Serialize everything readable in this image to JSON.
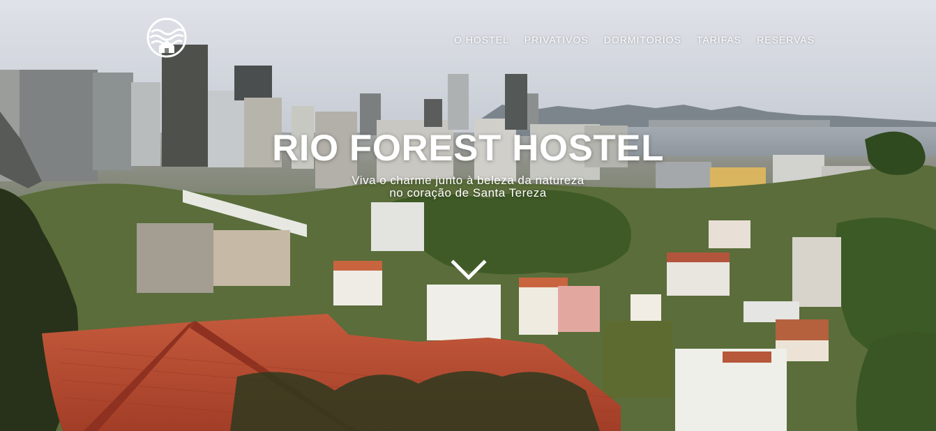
{
  "header": {
    "logo_icon": "wave-house-logo-icon"
  },
  "nav": {
    "items": [
      {
        "label": "O HOSTEL"
      },
      {
        "label": "PRIVATIVOS"
      },
      {
        "label": "DORMITORIOS"
      },
      {
        "label": "TARIFAS"
      },
      {
        "label": "RESERVAS"
      }
    ]
  },
  "hero": {
    "title": "RIO FOREST HOSTEL",
    "subtitle_line1": "Viva o charme junto à beleza da natureza",
    "subtitle_line2": "no coração de Santa Tereza",
    "scroll_icon": "chevron-down-icon"
  },
  "colors": {
    "text": "#ffffff",
    "sky": "#d7dbe3",
    "roof": "#b5482f",
    "foliage": "#4f6a2e"
  }
}
